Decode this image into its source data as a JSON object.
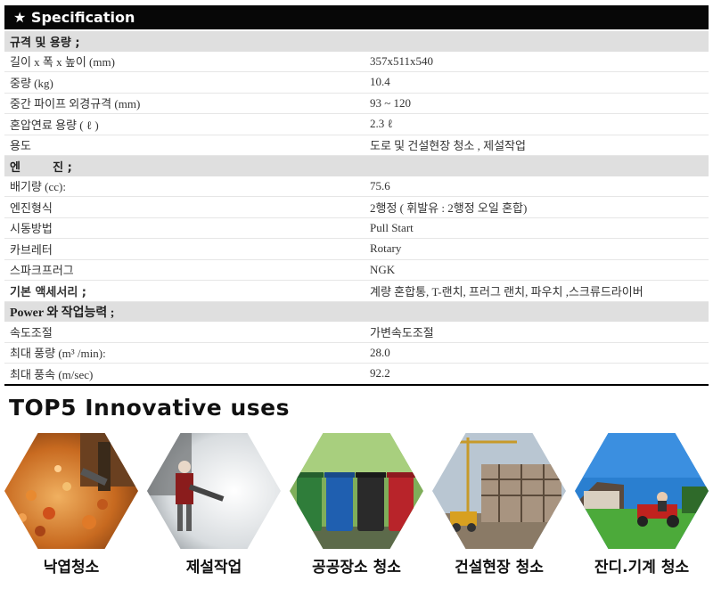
{
  "header": {
    "title": "★ Specification"
  },
  "spec_rows": [
    {
      "type": "section",
      "label": "규격 및 용량 ;"
    },
    {
      "type": "row",
      "label": "길이 x 폭 x 높이 (mm)",
      "value": "357x511x540"
    },
    {
      "type": "row",
      "label": "중량 (kg)",
      "value": "10.4"
    },
    {
      "type": "row",
      "label": "중간 파이프 외경규격 (mm)",
      "value": "93 ~ 120"
    },
    {
      "type": "row",
      "label": "혼압연료 용량 ( ℓ )",
      "value": "2.3 ℓ"
    },
    {
      "type": "row",
      "label": "용도",
      "value": "도로 및 건설현장  청소 , 제설작업"
    },
    {
      "type": "section",
      "label": "엔        진 ;"
    },
    {
      "type": "row",
      "label": "배기량  (cc):",
      "value": "75.6"
    },
    {
      "type": "row",
      "label": "엔진형식",
      "value": "2행정 ( 휘발유 : 2행정 오일 혼합)"
    },
    {
      "type": "row",
      "label": "시동방법",
      "value": "Pull Start"
    },
    {
      "type": "row",
      "label": "카브레터",
      "value": "Rotary"
    },
    {
      "type": "row",
      "label": "스파크프러그",
      "value": "NGK"
    },
    {
      "type": "bold",
      "label": "기본 액세서리 ;",
      "value": "계량 혼합통, T-랜치, 프러그 랜치, 파우치 ,스크류드라이버"
    },
    {
      "type": "section-alt",
      "label": "Power 와 작업능력 ;"
    },
    {
      "type": "row",
      "label": "속도조절",
      "value": "가변속도조절"
    },
    {
      "type": "row",
      "label": "최대 풍량 (m³  /min):",
      "value": "28.0"
    },
    {
      "type": "row",
      "label": "최대 풍속 (m/sec)",
      "value": "92.2"
    }
  ],
  "uses": {
    "title": "TOP5 Innovative uses",
    "items": [
      {
        "label": "낙엽청소",
        "image": "leaf-blowing-image"
      },
      {
        "label": "제설작업",
        "image": "snow-blowing-image"
      },
      {
        "label": "공공장소 청소",
        "image": "recycling-bins-image"
      },
      {
        "label": "건설현장 청소",
        "image": "construction-site-image"
      },
      {
        "label": "잔디.기계 청소",
        "image": "lawn-mower-image"
      }
    ]
  }
}
